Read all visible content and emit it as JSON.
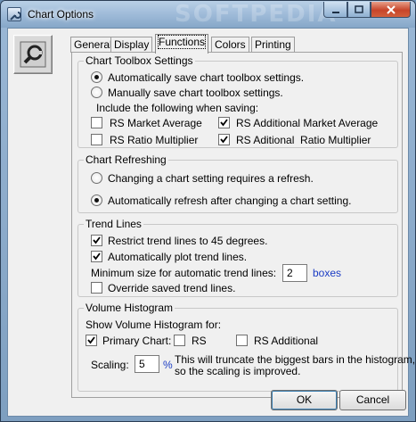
{
  "window": {
    "title": "Chart Options",
    "watermark": "SOFTPEDIA"
  },
  "tabs": [
    {
      "label": "General"
    },
    {
      "label": "Display"
    },
    {
      "label": "Functions",
      "active": true
    },
    {
      "label": "Colors"
    },
    {
      "label": "Printing"
    }
  ],
  "toolbox": {
    "title": "Chart Toolbox Settings",
    "auto_save": {
      "label": "Automatically save chart toolbox settings.",
      "selected": true
    },
    "manual_save": {
      "label": "Manually save chart toolbox settings.",
      "selected": false
    },
    "include_label": "Include the following when saving:",
    "rs_market_average": {
      "label": "RS Market Average",
      "checked": false
    },
    "rs_additional_market_average": {
      "label": "RS Additional Market Average",
      "checked": true
    },
    "rs_ratio_multiplier": {
      "label": "RS Ratio Multiplier",
      "checked": false
    },
    "rs_aditional_ratio_multiplier": {
      "label": "RS Aditional  Ratio Multiplier",
      "checked": true
    }
  },
  "refreshing": {
    "title": "Chart Refreshing",
    "requires_refresh": {
      "label": "Changing a chart setting requires a refresh.",
      "selected": false
    },
    "auto_refresh": {
      "label": "Automatically refresh after changing a chart setting.",
      "selected": true
    }
  },
  "trend": {
    "title": "Trend Lines",
    "restrict": {
      "label": "Restrict trend lines to 45 degrees.",
      "checked": true
    },
    "auto_plot": {
      "label": "Automatically plot trend lines.",
      "checked": true
    },
    "min_size_label": "Minimum size for automatic trend lines:",
    "min_size_value": "2",
    "min_size_unit": "boxes",
    "override": {
      "label": "Override saved trend lines.",
      "checked": false
    }
  },
  "histogram": {
    "title": "Volume Histogram",
    "show_label": "Show Volume Histogram for:",
    "primary_chart": {
      "label": "Primary Chart:",
      "checked": true
    },
    "rs": {
      "label": "RS",
      "checked": false
    },
    "rs_additional": {
      "label": "RS Additional",
      "checked": false
    },
    "scaling_label": "Scaling:",
    "scaling_value": "5",
    "scaling_unit": "%",
    "note_line1": "This will truncate the biggest bars in the histogram,",
    "note_line2": "so the scaling is improved."
  },
  "buttons": {
    "ok": "OK",
    "cancel": "Cancel"
  },
  "icons": {
    "app": "wrench-chart-icon",
    "side": "wrench-gear-icon",
    "minimize": "minimize-icon",
    "maximize": "maximize-icon",
    "close": "close-icon"
  }
}
